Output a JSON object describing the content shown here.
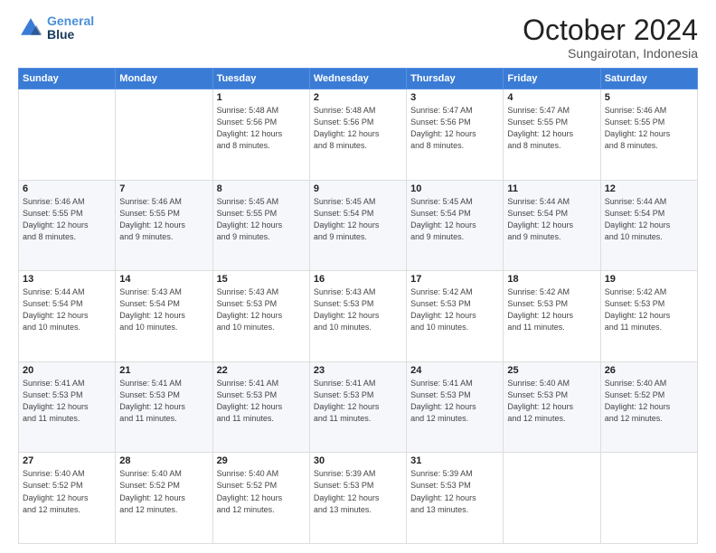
{
  "header": {
    "logo_line1": "General",
    "logo_line2": "Blue",
    "month": "October 2024",
    "location": "Sungairotan, Indonesia"
  },
  "days_of_week": [
    "Sunday",
    "Monday",
    "Tuesday",
    "Wednesday",
    "Thursday",
    "Friday",
    "Saturday"
  ],
  "weeks": [
    [
      {
        "day": "",
        "info": ""
      },
      {
        "day": "",
        "info": ""
      },
      {
        "day": "1",
        "info": "Sunrise: 5:48 AM\nSunset: 5:56 PM\nDaylight: 12 hours\nand 8 minutes."
      },
      {
        "day": "2",
        "info": "Sunrise: 5:48 AM\nSunset: 5:56 PM\nDaylight: 12 hours\nand 8 minutes."
      },
      {
        "day": "3",
        "info": "Sunrise: 5:47 AM\nSunset: 5:56 PM\nDaylight: 12 hours\nand 8 minutes."
      },
      {
        "day": "4",
        "info": "Sunrise: 5:47 AM\nSunset: 5:55 PM\nDaylight: 12 hours\nand 8 minutes."
      },
      {
        "day": "5",
        "info": "Sunrise: 5:46 AM\nSunset: 5:55 PM\nDaylight: 12 hours\nand 8 minutes."
      }
    ],
    [
      {
        "day": "6",
        "info": "Sunrise: 5:46 AM\nSunset: 5:55 PM\nDaylight: 12 hours\nand 8 minutes."
      },
      {
        "day": "7",
        "info": "Sunrise: 5:46 AM\nSunset: 5:55 PM\nDaylight: 12 hours\nand 9 minutes."
      },
      {
        "day": "8",
        "info": "Sunrise: 5:45 AM\nSunset: 5:55 PM\nDaylight: 12 hours\nand 9 minutes."
      },
      {
        "day": "9",
        "info": "Sunrise: 5:45 AM\nSunset: 5:54 PM\nDaylight: 12 hours\nand 9 minutes."
      },
      {
        "day": "10",
        "info": "Sunrise: 5:45 AM\nSunset: 5:54 PM\nDaylight: 12 hours\nand 9 minutes."
      },
      {
        "day": "11",
        "info": "Sunrise: 5:44 AM\nSunset: 5:54 PM\nDaylight: 12 hours\nand 9 minutes."
      },
      {
        "day": "12",
        "info": "Sunrise: 5:44 AM\nSunset: 5:54 PM\nDaylight: 12 hours\nand 10 minutes."
      }
    ],
    [
      {
        "day": "13",
        "info": "Sunrise: 5:44 AM\nSunset: 5:54 PM\nDaylight: 12 hours\nand 10 minutes."
      },
      {
        "day": "14",
        "info": "Sunrise: 5:43 AM\nSunset: 5:54 PM\nDaylight: 12 hours\nand 10 minutes."
      },
      {
        "day": "15",
        "info": "Sunrise: 5:43 AM\nSunset: 5:53 PM\nDaylight: 12 hours\nand 10 minutes."
      },
      {
        "day": "16",
        "info": "Sunrise: 5:43 AM\nSunset: 5:53 PM\nDaylight: 12 hours\nand 10 minutes."
      },
      {
        "day": "17",
        "info": "Sunrise: 5:42 AM\nSunset: 5:53 PM\nDaylight: 12 hours\nand 10 minutes."
      },
      {
        "day": "18",
        "info": "Sunrise: 5:42 AM\nSunset: 5:53 PM\nDaylight: 12 hours\nand 11 minutes."
      },
      {
        "day": "19",
        "info": "Sunrise: 5:42 AM\nSunset: 5:53 PM\nDaylight: 12 hours\nand 11 minutes."
      }
    ],
    [
      {
        "day": "20",
        "info": "Sunrise: 5:41 AM\nSunset: 5:53 PM\nDaylight: 12 hours\nand 11 minutes."
      },
      {
        "day": "21",
        "info": "Sunrise: 5:41 AM\nSunset: 5:53 PM\nDaylight: 12 hours\nand 11 minutes."
      },
      {
        "day": "22",
        "info": "Sunrise: 5:41 AM\nSunset: 5:53 PM\nDaylight: 12 hours\nand 11 minutes."
      },
      {
        "day": "23",
        "info": "Sunrise: 5:41 AM\nSunset: 5:53 PM\nDaylight: 12 hours\nand 11 minutes."
      },
      {
        "day": "24",
        "info": "Sunrise: 5:41 AM\nSunset: 5:53 PM\nDaylight: 12 hours\nand 12 minutes."
      },
      {
        "day": "25",
        "info": "Sunrise: 5:40 AM\nSunset: 5:53 PM\nDaylight: 12 hours\nand 12 minutes."
      },
      {
        "day": "26",
        "info": "Sunrise: 5:40 AM\nSunset: 5:52 PM\nDaylight: 12 hours\nand 12 minutes."
      }
    ],
    [
      {
        "day": "27",
        "info": "Sunrise: 5:40 AM\nSunset: 5:52 PM\nDaylight: 12 hours\nand 12 minutes."
      },
      {
        "day": "28",
        "info": "Sunrise: 5:40 AM\nSunset: 5:52 PM\nDaylight: 12 hours\nand 12 minutes."
      },
      {
        "day": "29",
        "info": "Sunrise: 5:40 AM\nSunset: 5:52 PM\nDaylight: 12 hours\nand 12 minutes."
      },
      {
        "day": "30",
        "info": "Sunrise: 5:39 AM\nSunset: 5:53 PM\nDaylight: 12 hours\nand 13 minutes."
      },
      {
        "day": "31",
        "info": "Sunrise: 5:39 AM\nSunset: 5:53 PM\nDaylight: 12 hours\nand 13 minutes."
      },
      {
        "day": "",
        "info": ""
      },
      {
        "day": "",
        "info": ""
      }
    ]
  ]
}
